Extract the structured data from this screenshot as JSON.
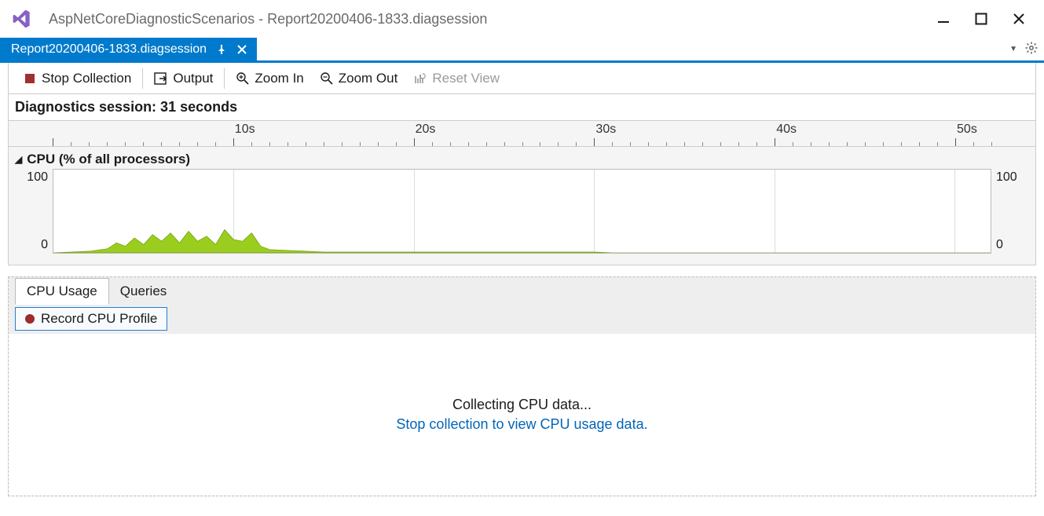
{
  "window": {
    "title": "AspNetCoreDiagnosticScenarios - Report20200406-1833.diagsession"
  },
  "tab": {
    "label": "Report20200406-1833.diagsession"
  },
  "toolbar": {
    "stop": "Stop Collection",
    "output": "Output",
    "zoom_in": "Zoom In",
    "zoom_out": "Zoom Out",
    "reset_view": "Reset View"
  },
  "session": {
    "label": "Diagnostics session: 31 seconds"
  },
  "ruler": {
    "max_seconds": 52,
    "major_every": 10,
    "labels_suffix": "s"
  },
  "chart": {
    "title": "CPU (% of all processors)",
    "y_top": "100",
    "y_bottom": "0"
  },
  "bottom_tabs": {
    "tab1": "CPU Usage",
    "tab2": "Queries"
  },
  "record": {
    "label": "Record CPU Profile"
  },
  "status": {
    "line1": "Collecting CPU data...",
    "line2": "Stop collection to view CPU usage data."
  },
  "chart_data": {
    "type": "area",
    "title": "CPU (% of all processors)",
    "xlabel": "seconds",
    "ylabel": "CPU %",
    "xlim": [
      0,
      52
    ],
    "ylim": [
      0,
      100
    ],
    "x": [
      0,
      1,
      2,
      3,
      3.5,
      4,
      4.5,
      5,
      5.5,
      6,
      6.5,
      7,
      7.5,
      8,
      8.5,
      9,
      9.5,
      10,
      10.5,
      11,
      11.5,
      12,
      13,
      14,
      15,
      20,
      25,
      30,
      31,
      52
    ],
    "values": [
      0,
      1,
      2,
      5,
      12,
      8,
      18,
      10,
      22,
      14,
      24,
      12,
      26,
      14,
      20,
      10,
      28,
      16,
      14,
      24,
      8,
      4,
      3,
      2,
      1,
      1,
      1,
      1,
      0,
      0
    ]
  }
}
